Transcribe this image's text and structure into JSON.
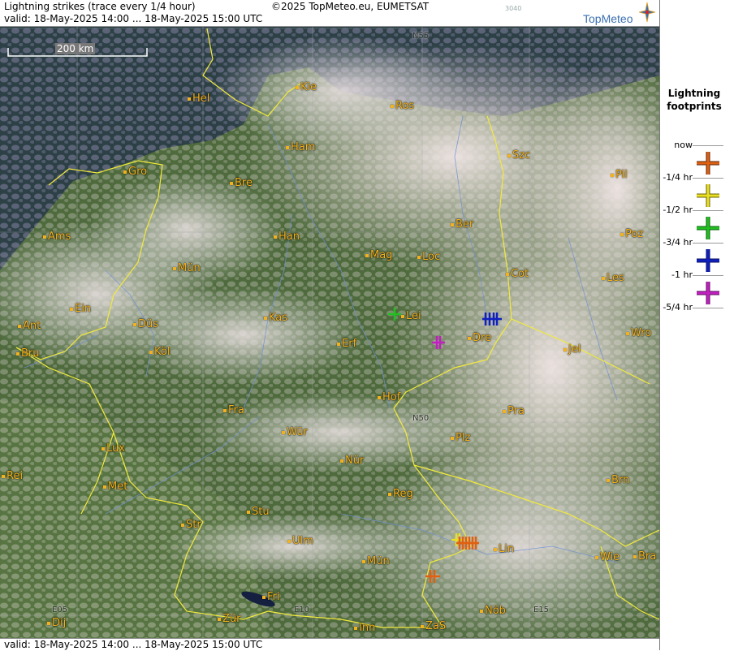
{
  "header": {
    "title": "Lightning strikes (trace every 1/4 hour)",
    "valid": "valid:  18-May-2025 14:00 ... 18-May-2025 15:00 UTC",
    "copyright": "©2025 TopMeteo.eu, EUMETSAT",
    "code": "3040",
    "logo": "TopMeteo"
  },
  "footer": {
    "valid": "valid:  18-May-2025 14:00 ... 18-May-2025 15:00 UTC"
  },
  "map": {
    "scale_label": "200 km",
    "grid_labels": [
      "N55",
      "N50",
      "E05",
      "E10",
      "E15"
    ],
    "cities": [
      "Kie",
      "Hel",
      "Ros",
      "Ham",
      "Szc",
      "Gro",
      "Bre",
      "Pil",
      "Ber",
      "Ams",
      "Han",
      "Poz",
      "Mag",
      "Loc",
      "Mün",
      "Cot",
      "Les",
      "Ein",
      "Kas",
      "Lei",
      "Ant",
      "Düs",
      "Wro",
      "Bru",
      "Köl",
      "Erf",
      "Dre",
      "Jel",
      "Hof",
      "Fra",
      "Pra",
      "Wür",
      "Plz",
      "Lux",
      "Nür",
      "Rei",
      "Met",
      "Brn",
      "Reg",
      "Stu",
      "Str",
      "Ulm",
      "Lin",
      "Mün",
      "Wie",
      "Bra",
      "Fri",
      "Dij",
      "Zür",
      "Inn",
      "ZaS",
      "Nöb"
    ],
    "colors": {
      "city": "#f3b21b",
      "border": "#f2ea3a",
      "river": "#6f8fd8"
    }
  },
  "legend": {
    "title_line1": "Lightning",
    "title_line2": "footprints",
    "entries": [
      {
        "label": "now",
        "color": "#e06010",
        "icon": "cross-marker-icon"
      },
      {
        "label": "-1/4 hr",
        "color": "#e8e020",
        "icon": "cross-marker-icon"
      },
      {
        "label": "-1/2 hr",
        "color": "#20c020",
        "icon": "cross-marker-icon"
      },
      {
        "label": "-3/4 hr",
        "color": "#1020c0",
        "icon": "cross-marker-icon"
      },
      {
        "label": "-1 hr",
        "color": "#c020c0",
        "icon": "cross-marker-icon"
      },
      {
        "label": "-5/4 hr",
        "color": "#c020c0",
        "icon": "cross-marker-icon"
      }
    ]
  }
}
